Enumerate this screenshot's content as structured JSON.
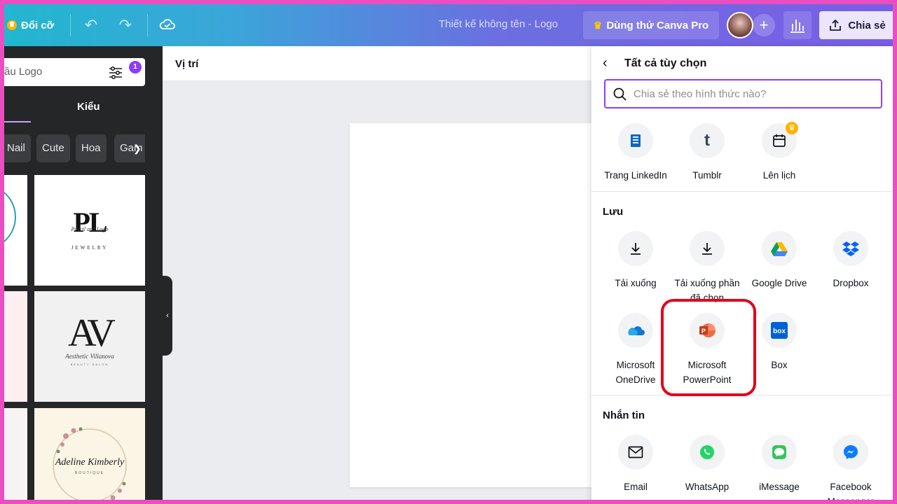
{
  "topbar": {
    "resize_label": "Đổi cỡ",
    "doc_title": "Thiết kế không tên - Logo",
    "pro_label": "Dùng thử Canva Pro",
    "share_label": "Chia sẻ"
  },
  "left_panel": {
    "search_text": "ầu Logo",
    "filter_count": "1",
    "tab_style": "Kiểu",
    "chips": [
      "Nail",
      "Cute",
      "Hoa",
      "Gam"
    ],
    "thumbs": {
      "pl_letters": "PL",
      "pl_script": "Pencil and Logo",
      "pl_sub": "JEWELRY",
      "av_letters": "AV",
      "av_script": "Aesthetic Villanova",
      "av_sub": "BEAUTY SALON",
      "wreath_script": "Adeline Kimberly",
      "wreath_sub": "BOUTIQUE"
    }
  },
  "canvas": {
    "toolbar_label": "Vị trí"
  },
  "share_panel": {
    "back_label": "Tất cả tùy chọn",
    "search_placeholder": "Chia sẻ theo hình thức nào?",
    "top_options": [
      {
        "label": "Trang LinkedIn",
        "icon": "linkedin-page-icon"
      },
      {
        "label": "Tumblr",
        "icon": "tumblr-icon"
      },
      {
        "label": "Lên lịch",
        "icon": "calendar-icon",
        "pro": true
      }
    ],
    "save_section": "Lưu",
    "save_options": [
      {
        "label": "Tải xuống",
        "icon": "download-icon"
      },
      {
        "label": "Tải xuống phần đã chọn",
        "icon": "download-selected-icon"
      },
      {
        "label": "Google Drive",
        "icon": "google-drive-icon"
      },
      {
        "label": "Dropbox",
        "icon": "dropbox-icon"
      },
      {
        "label": "Microsoft OneDrive",
        "icon": "onedrive-icon"
      },
      {
        "label": "Microsoft PowerPoint",
        "icon": "powerpoint-icon"
      },
      {
        "label": "Box",
        "icon": "box-icon"
      }
    ],
    "message_section": "Nhắn tin",
    "message_options": [
      {
        "label": "Email",
        "icon": "email-icon"
      },
      {
        "label": "WhatsApp",
        "icon": "whatsapp-icon"
      },
      {
        "label": "iMessage",
        "icon": "imessage-icon"
      },
      {
        "label": "Facebook Messenger",
        "icon": "messenger-icon"
      }
    ]
  },
  "colors": {
    "accent": "#8b3dff",
    "highlight": "#e3041b",
    "frame": "#ea4ec0"
  }
}
